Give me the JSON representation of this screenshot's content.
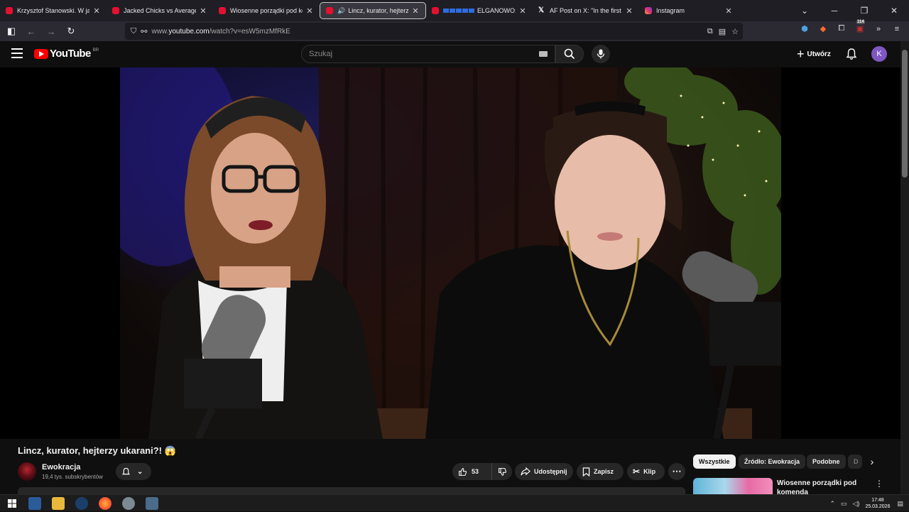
{
  "browser": {
    "tabs": [
      {
        "label": "Krzysztof Stanowski. W jakiej sp",
        "icon": "youtube-icon",
        "active": false
      },
      {
        "label": "Jacked Chicks vs Average Joes |",
        "icon": "youtube-icon",
        "active": false
      },
      {
        "label": "Wiosenne porządki pod komen",
        "icon": "youtube-icon",
        "active": false
      },
      {
        "label": "Lincz, kurator, hejterzy ukar",
        "icon": "youtube-icon",
        "active": true,
        "audio": true
      },
      {
        "label": "ELGANOWO: D",
        "icon": "youtube-icon",
        "active": false
      },
      {
        "label": "AF Post on X: \"In the first nine n",
        "icon": "x-icon",
        "active": false
      },
      {
        "label": "Instagram",
        "icon": "instagram-icon",
        "active": false
      }
    ],
    "url_prefix": "www.",
    "url_host": "youtube.com",
    "url_path": "/watch?v=esW5mzMfRkE",
    "extension_badge": "114"
  },
  "youtube": {
    "logo_text": "YouTube",
    "country_code": "BR",
    "search_placeholder": "Szukaj",
    "create_label": "Utwórz",
    "avatar_letter": "K"
  },
  "video": {
    "title": "Lincz, kurator, hejterzy ukarani?! 😱",
    "channel_name": "Ewokracja",
    "subscribers": "19,4 tys. subskrybentów",
    "likes": "53",
    "share_label": "Udostępnij",
    "save_label": "Zapisz",
    "clip_label": "Klip",
    "more_label": "⋯"
  },
  "sidebar": {
    "chips": [
      {
        "label": "Wszystkie",
        "active": true
      },
      {
        "label": "Źródło: Ewokracja",
        "active": false
      },
      {
        "label": "Podobne",
        "active": false
      },
      {
        "label": "D",
        "active": false
      }
    ],
    "related": [
      {
        "title": "Wiosenne porządki pod komenda"
      }
    ]
  },
  "taskbar": {
    "time": "17:48",
    "date": "25.03.2026"
  },
  "colors": {
    "yt_red": "#ff0000",
    "avatar": "#7e57c2",
    "chip_active": "#f1f1f1"
  }
}
